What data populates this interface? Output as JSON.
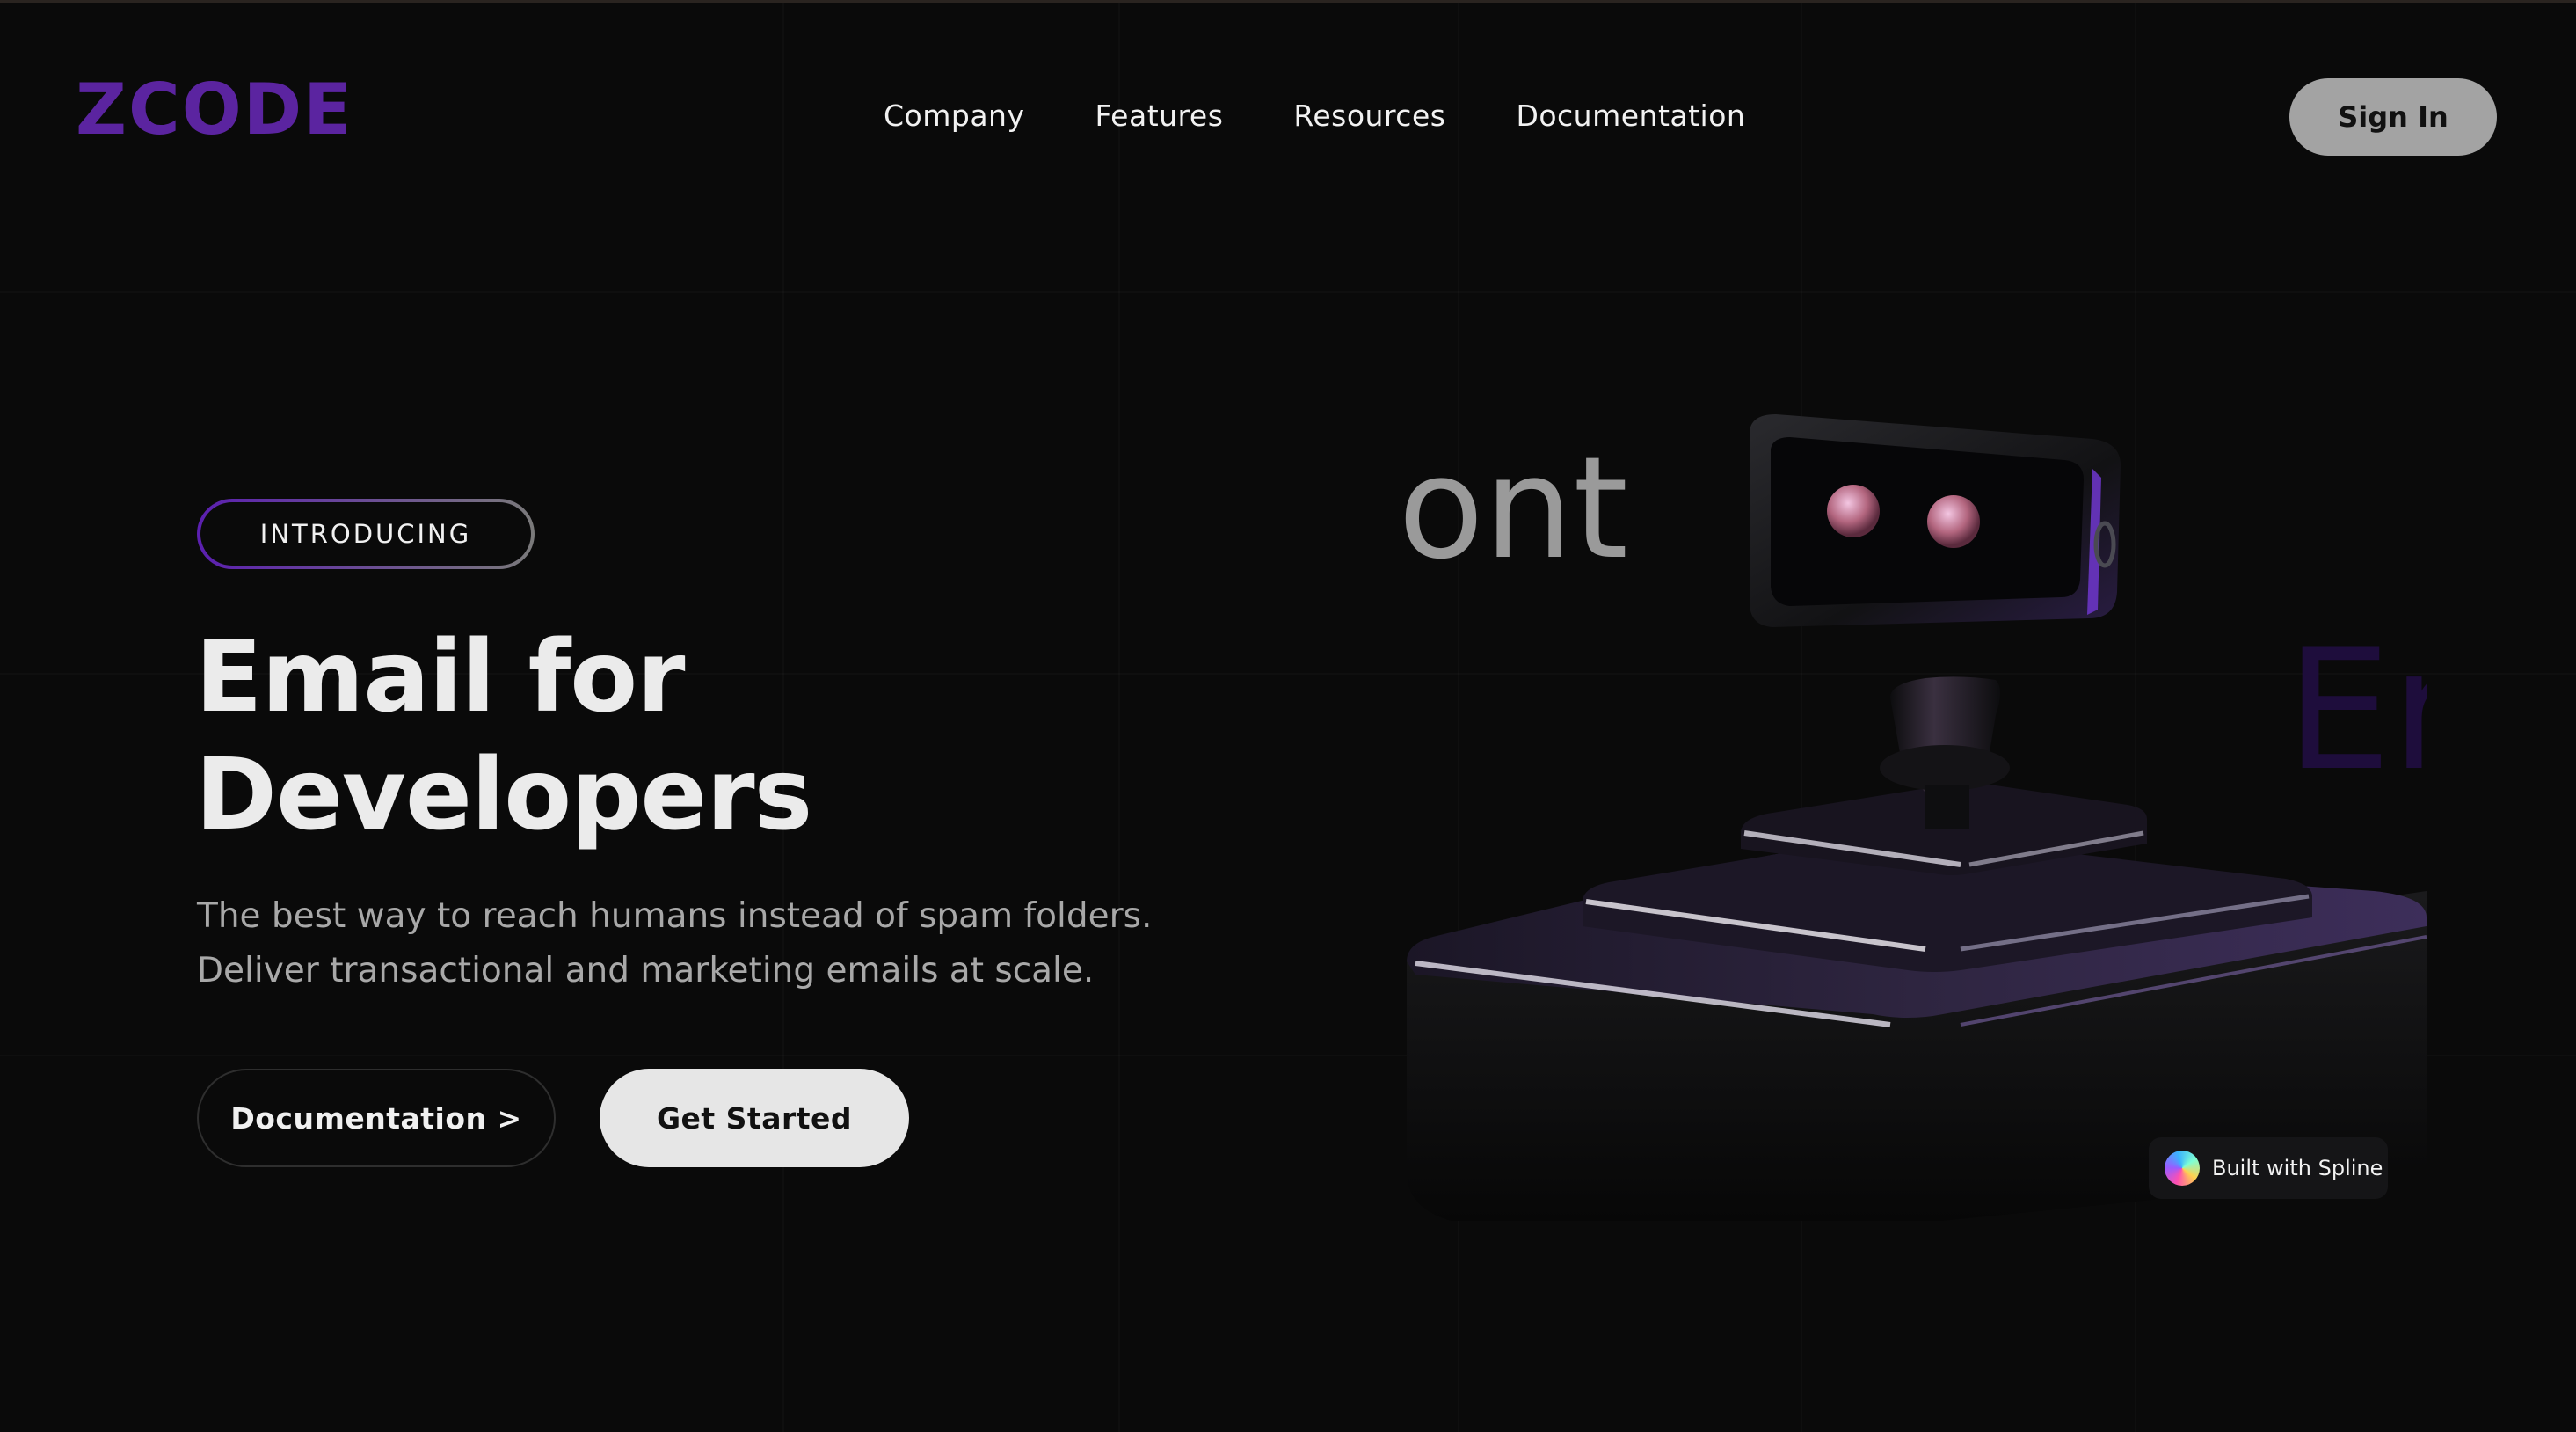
{
  "brand": {
    "logo_text": "ZCODE",
    "color": "#5b24a0"
  },
  "nav": {
    "items": [
      {
        "label": "Company"
      },
      {
        "label": "Features"
      },
      {
        "label": "Resources"
      },
      {
        "label": "Documentation"
      }
    ],
    "signin_label": "Sign In"
  },
  "hero": {
    "badge": "INTRODUCING",
    "headline_line1": "Email for",
    "headline_line2": "Developers",
    "subtitle": "The best way to reach humans instead of spam folders. Deliver transactional and marketing emails at scale.",
    "cta_docs": "Documentation >",
    "cta_start": "Get Started"
  },
  "scene": {
    "floating_text_left": "ont",
    "floating_text_right": "Er",
    "badge_label": "Built with Spline"
  },
  "colors": {
    "background": "#0a0a0a",
    "accent_purple": "#5b24a0",
    "signin_bg": "#a3a3a3",
    "start_bg": "#e6e6e6"
  }
}
